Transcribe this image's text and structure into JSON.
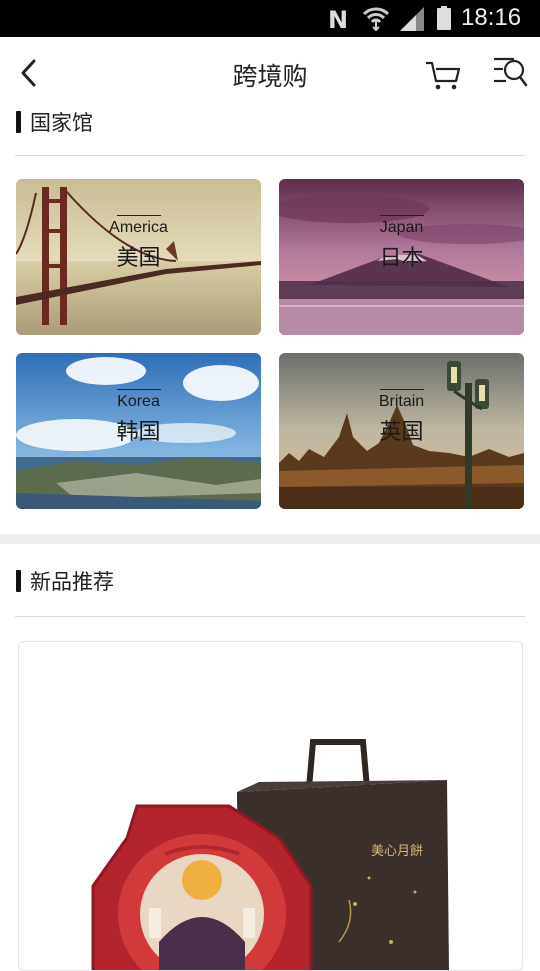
{
  "status_bar": {
    "carrier_glyph": "N",
    "time": "18:16"
  },
  "nav": {
    "title": "跨境购",
    "back_icon": "chevron-left-icon",
    "cart_icon": "cart-icon",
    "search_icon": "search-menu-icon"
  },
  "sections": {
    "pavilion": {
      "title": "国家馆"
    },
    "new_products": {
      "title": "新品推荐"
    }
  },
  "countries": [
    {
      "en": "America",
      "zh": "美国"
    },
    {
      "en": "Japan",
      "zh": "日本"
    },
    {
      "en": "Korea",
      "zh": "韩国"
    },
    {
      "en": "Britain",
      "zh": "英国"
    }
  ],
  "product": {
    "brand_text": "美心月餅"
  }
}
